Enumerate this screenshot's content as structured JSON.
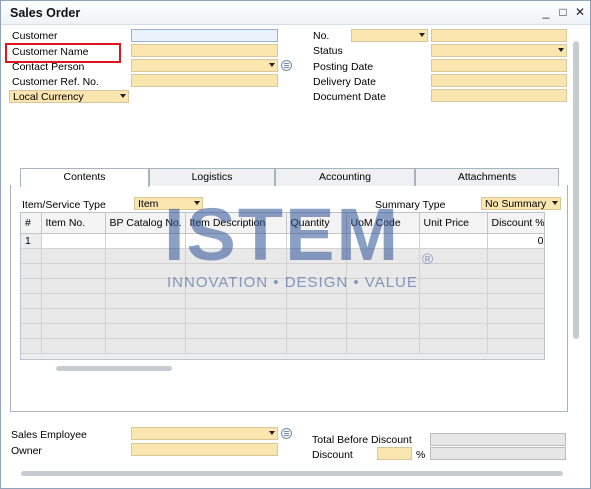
{
  "window": {
    "title": "Sales Order",
    "minimize_glyph": "_",
    "maximize_glyph": "□",
    "close_glyph": "✕"
  },
  "header": {
    "customer_label": "Customer",
    "customer_name_label": "Customer Name",
    "contact_person_label": "Contact Person",
    "customer_ref_label": "Customer Ref. No.",
    "currency_value": "Local Currency",
    "no_label": "No.",
    "status_label": "Status",
    "posting_date_label": "Posting Date",
    "delivery_date_label": "Delivery Date",
    "document_date_label": "Document Date"
  },
  "tabs": [
    {
      "label": "Contents"
    },
    {
      "label": "Logistics"
    },
    {
      "label": "Accounting"
    },
    {
      "label": "Attachments"
    }
  ],
  "contents": {
    "item_service_type_label": "Item/Service Type",
    "item_service_type_value": "Item",
    "summary_type_label": "Summary Type",
    "summary_type_value": "No Summary"
  },
  "grid": {
    "columns": [
      "#",
      "Item No.",
      "BP Catalog No.",
      "Item Description",
      "Quantity",
      "UoM Code",
      "Unit Price",
      "Discount %"
    ],
    "first_row": {
      "row_number": "1",
      "discount": "0"
    }
  },
  "watermark": {
    "brand": "ISTEM",
    "tagline": "INNOVATION • DESIGN • VALUE",
    "registered": "®"
  },
  "footer": {
    "sales_employee_label": "Sales Employee",
    "owner_label": "Owner",
    "total_before_discount_label": "Total Before Discount",
    "discount_label": "Discount",
    "percent_sign": "%"
  },
  "highlight_color": "#e0141e"
}
